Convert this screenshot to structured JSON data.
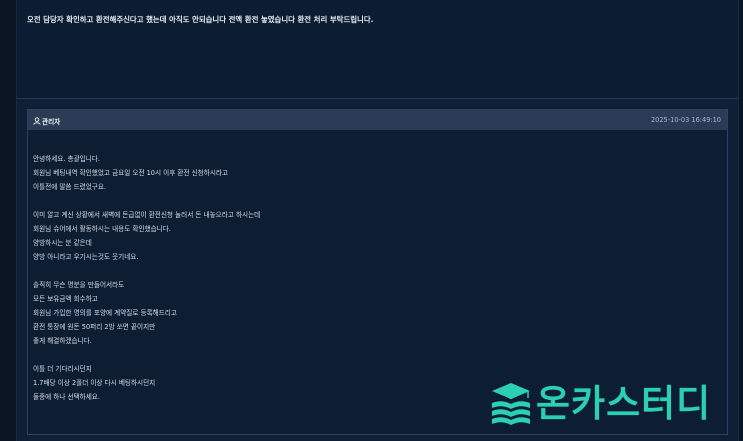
{
  "question": {
    "text": "오전 담당자 확인하고 환전해주신다고 했는데 아직도 안되습니다 전액 환전 놓였습니다 환전 처리 부탁드립니다."
  },
  "reply": {
    "author": "관리자",
    "date": "2025-10-03 16:49:10",
    "lines": [
      "안녕하세요. 총괄입니다.",
      "회원님 베팅내역 확인했었고 금요일 오전 10시 이후 환전 신청하시라고",
      "이틀전에 말씀 드렸었구요.",
      "",
      "이미 알고 계신 상황에서 새벽에 돈급없이 환전신청 눌러서 돈 내놓으라고 하시는데",
      "회원님 슈어에서 활동하시는 내용도 확인했습니다.",
      "양방하시는 분 같은데",
      "양방 아니라고 우기시는것도 웃기네요.",
      "",
      "솔직히 무슨 명분을 만들어서라도",
      "모든 보유금액 회수하고",
      "회원님 가입한 명의를 포양에 계약질로 등록해드리고",
      "환전 통장에 원돈 50퍼리 2방 쏘면 끝이지만",
      "좋게 해결하겠습니다.",
      "",
      "이틀 더 기다리시던지",
      "1.7배당 이상 2폴더 이상 다시 베팅하시던지",
      "둘중에 하나 선택하세요."
    ]
  },
  "watermark": {
    "text": "온카스터디",
    "icon": "book-stack-graduation-cap-icon",
    "color": "#2bd0b3"
  }
}
